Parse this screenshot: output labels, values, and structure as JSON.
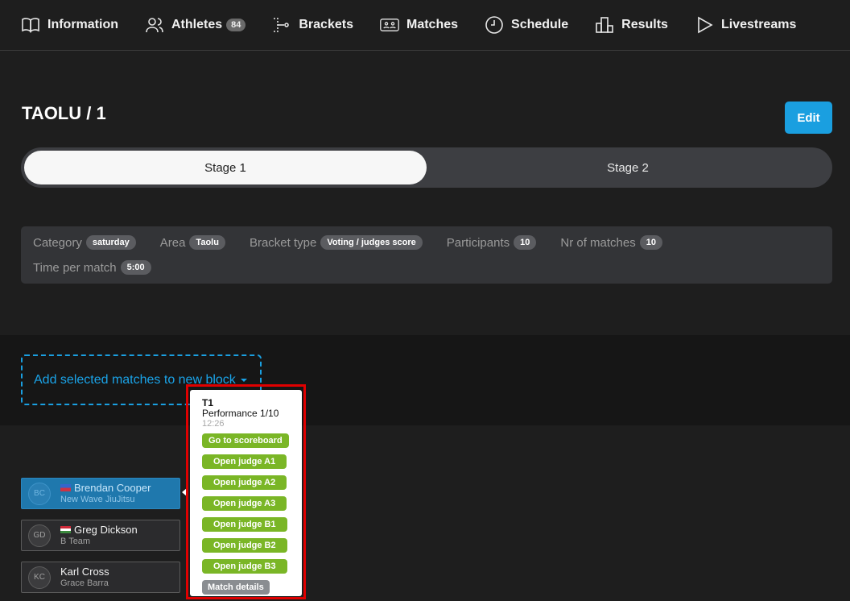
{
  "nav": {
    "information": "Information",
    "athletes": "Athletes",
    "athletes_count": "84",
    "brackets": "Brackets",
    "matches": "Matches",
    "schedule": "Schedule",
    "results": "Results",
    "livestreams": "Livestreams"
  },
  "page": {
    "title": "TAOLU / 1",
    "edit_label": "Edit"
  },
  "stages": {
    "stage1": "Stage 1",
    "stage2": "Stage 2"
  },
  "info": {
    "category_label": "Category",
    "category_value": "saturday",
    "area_label": "Area",
    "area_value": "Taolu",
    "bracket_type_label": "Bracket type",
    "bracket_type_value": "Voting / judges score",
    "participants_label": "Participants",
    "participants_value": "10",
    "nr_matches_label": "Nr of matches",
    "nr_matches_value": "10",
    "time_label": "Time per match",
    "time_value": "5:00"
  },
  "block": {
    "add_label": "Add selected matches to new block"
  },
  "athletes": [
    {
      "initials": "BC",
      "name": "Brendan Cooper",
      "team": "New Wave JiuJitsu"
    },
    {
      "initials": "GD",
      "name": "Greg Dickson",
      "team": "B Team"
    },
    {
      "initials": "KC",
      "name": "Karl Cross",
      "team": "Grace Barra"
    }
  ],
  "popup": {
    "title": "T1",
    "subtitle": "Performance 1/10",
    "time": "12:26",
    "scoreboard": "Go to scoreboard",
    "judge_a1": "Open judge A1",
    "judge_a2": "Open judge A2",
    "judge_a3": "Open judge A3",
    "judge_b1": "Open judge B1",
    "judge_b2": "Open judge B2",
    "judge_b3": "Open judge B3",
    "details": "Match details"
  },
  "colors": {
    "accent": "#1a9fe0",
    "green": "#7ab626",
    "highlight": "#e00000",
    "selected": "#1f78ad"
  }
}
